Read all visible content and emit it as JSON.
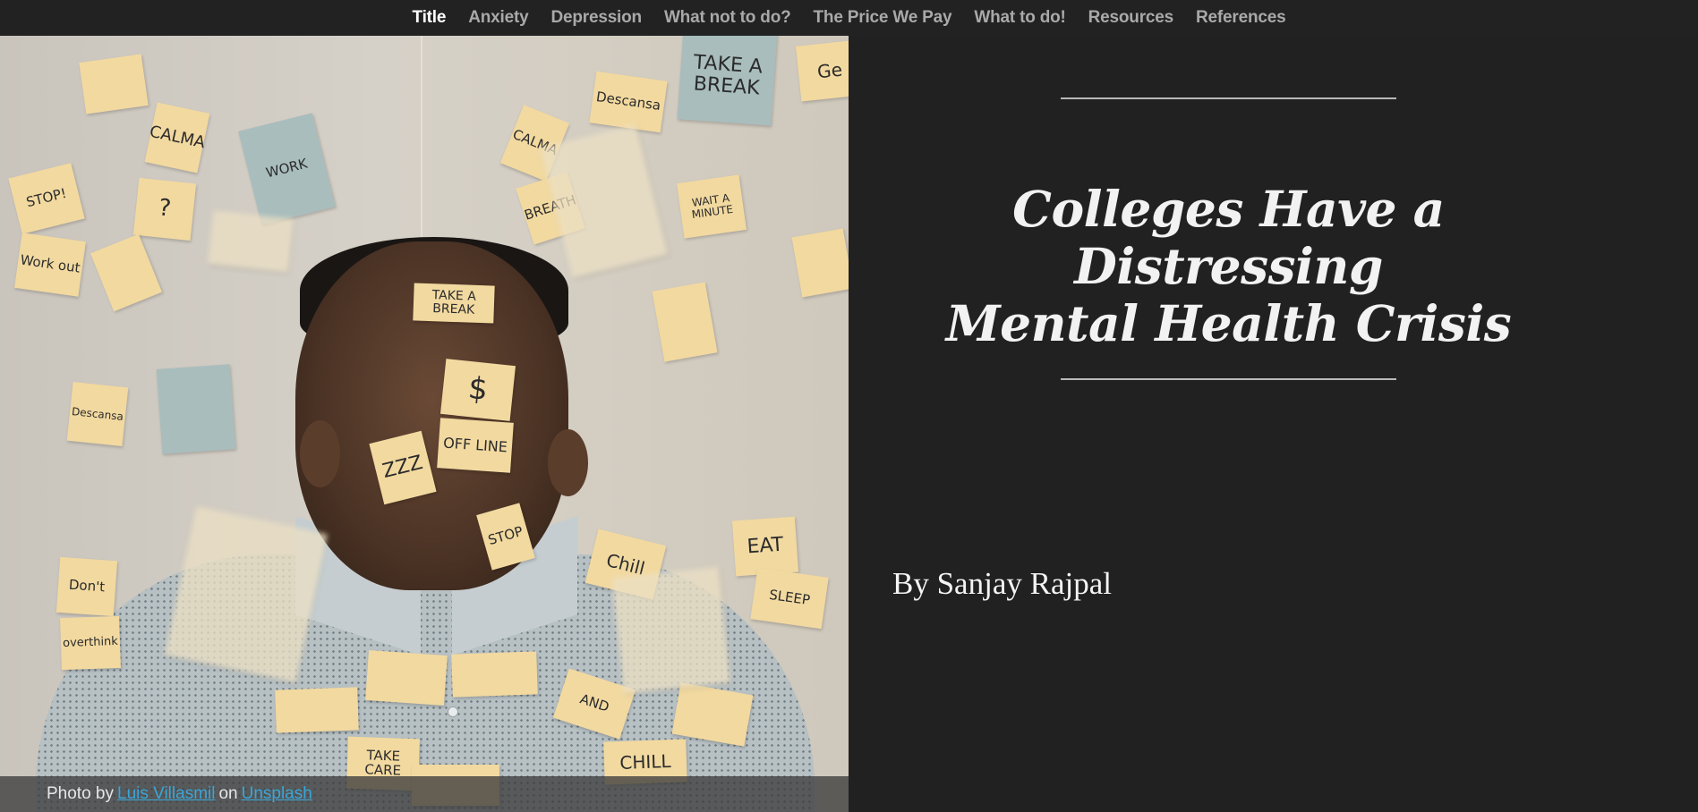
{
  "nav": {
    "items": [
      {
        "label": "Title",
        "active": true
      },
      {
        "label": "Anxiety",
        "active": false
      },
      {
        "label": "Depression",
        "active": false
      },
      {
        "label": "What not to do?",
        "active": false
      },
      {
        "label": "The Price We Pay",
        "active": false
      },
      {
        "label": "What to do!",
        "active": false
      },
      {
        "label": "Resources",
        "active": false
      },
      {
        "label": "References",
        "active": false
      }
    ]
  },
  "photo": {
    "notes": [
      "TAKE A BREAK",
      "Descansa",
      "Ge",
      "CALMA",
      "STOP!",
      "?",
      "Work out",
      "WORK",
      "CALMA",
      "BREATH",
      "WAIT A MINUTE",
      "TAKE A BREAK",
      "$",
      "OFF LINE",
      "ZZZ",
      "STOP",
      "Chill",
      "EAT",
      "SLEEP",
      "Don't",
      "overthink",
      "AND",
      "TAKE CARE",
      "CHILL",
      "Descansa"
    ],
    "credit": {
      "prefix": "Photo by",
      "author": "Luis Villasmil",
      "middle": "on",
      "site": "Unsplash"
    }
  },
  "hero": {
    "title_line1": "Colleges Have a Distressing",
    "title_line2": "Mental Health Crisis",
    "byline": "By Sanjay Rajpal"
  },
  "colors": {
    "background": "#212121",
    "nav_active": "#ffffff",
    "nav_inactive": "#a9a9a9",
    "link": "#3aa6d8"
  }
}
